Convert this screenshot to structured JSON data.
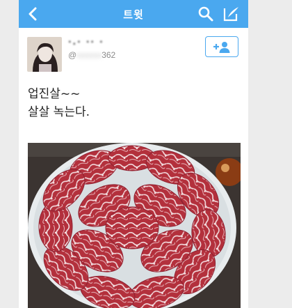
{
  "topbar": {
    "title": "트윗",
    "back_icon": "chevron-left-icon",
    "search_icon": "search-icon",
    "compose_icon": "compose-icon"
  },
  "user": {
    "display_name": "·.· ·· ·",
    "handle_prefix": "@",
    "handle_blurred": "xxxxxx",
    "handle_suffix": "362",
    "follow_icon": "add-user-icon"
  },
  "tweet": {
    "line1": "업진살~~",
    "line2": "살살 녹는다."
  },
  "colors": {
    "accent": "#4aa8ef",
    "meat": "#b3303c",
    "marbling": "#f2d9dc"
  }
}
